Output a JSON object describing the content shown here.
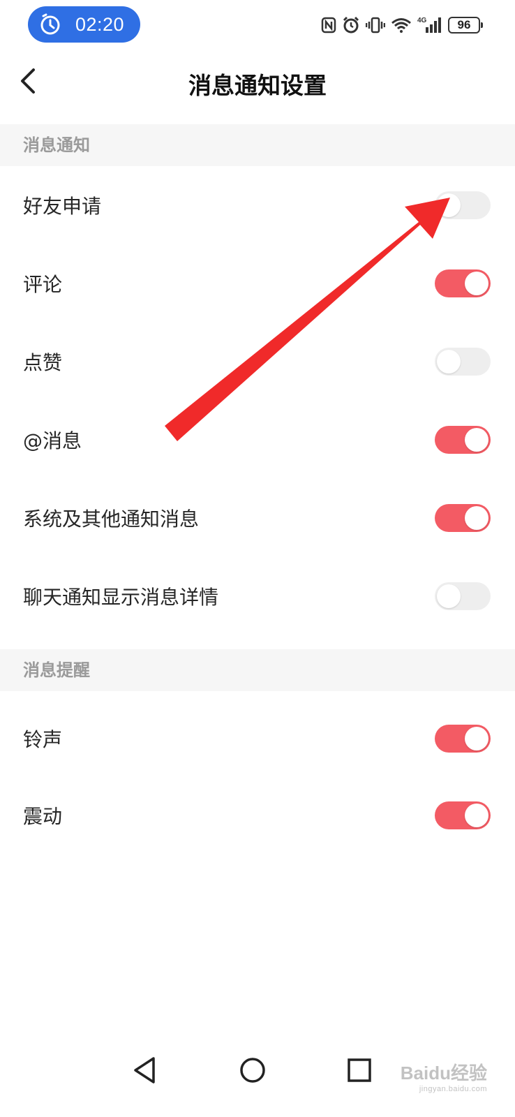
{
  "status_bar": {
    "timer": "02:20",
    "battery": "96",
    "network": "4G"
  },
  "header": {
    "title": "消息通知设置"
  },
  "sections": [
    {
      "title": "消息通知",
      "items": [
        {
          "label": "好友申请",
          "enabled": false
        },
        {
          "label": "评论",
          "enabled": true
        },
        {
          "label": "点赞",
          "enabled": false
        },
        {
          "label": "@消息",
          "enabled": true
        },
        {
          "label": "系统及其他通知消息",
          "enabled": true
        },
        {
          "label": "聊天通知显示消息详情",
          "enabled": false
        }
      ]
    },
    {
      "title": "消息提醒",
      "items": [
        {
          "label": "铃声",
          "enabled": true
        },
        {
          "label": "震动",
          "enabled": true
        }
      ]
    }
  ],
  "colors": {
    "toggle_on": "#f35b64",
    "toggle_off": "#eeeeee",
    "annotation_arrow": "#f02a2a",
    "timer_pill": "#2f6fe4"
  },
  "icons": {
    "back": "chevron-left-icon",
    "nav_back": "triangle-back-icon",
    "nav_home": "circle-home-icon",
    "nav_recent": "square-recents-icon"
  },
  "watermark": {
    "text": "Baidu经验",
    "sub": "jingyan.baidu.com"
  }
}
